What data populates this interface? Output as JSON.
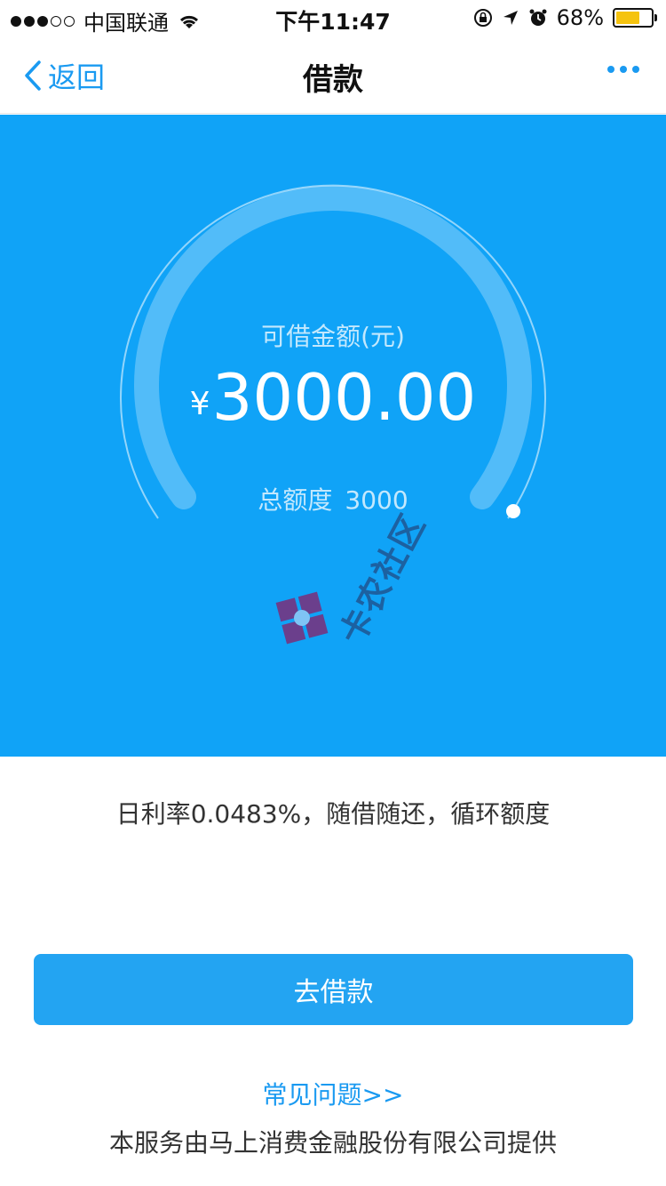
{
  "status_bar": {
    "carrier": "中国联通",
    "time": "下午11:47",
    "battery": "68%",
    "battery_level": 0.68
  },
  "nav": {
    "back_label": "返回",
    "title": "借款",
    "more_icon": "more-dots-icon"
  },
  "hero": {
    "available_label": "可借金额(元)",
    "currency_symbol": "¥",
    "available_amount": "3000.00",
    "total_label": "总额度",
    "total_value": "3000",
    "gauge_fraction": 1.0
  },
  "watermark": {
    "text": "卡农社区"
  },
  "info": {
    "rate_text": "日利率0.0483%，随借随还，循环额度"
  },
  "actions": {
    "borrow_label": "去借款",
    "faq_label": "常见问题>>"
  },
  "footer": {
    "provider_text": "本服务由马上消费金融股份有限公司提供"
  },
  "colors": {
    "primary": "#10a3f7",
    "button": "#23a4f2",
    "link": "#1a9af1"
  }
}
